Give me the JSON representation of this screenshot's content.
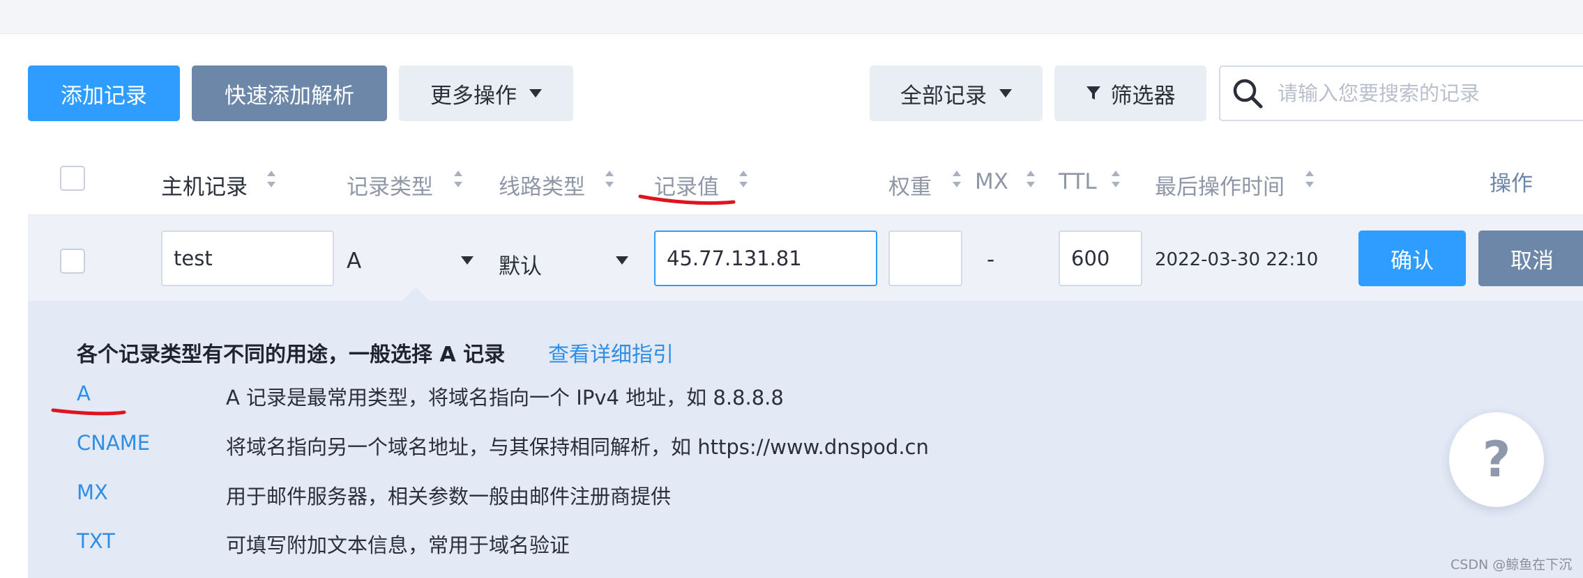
{
  "toolbar": {
    "add_record": "添加记录",
    "quick_add": "快速添加解析",
    "more_actions": "更多操作",
    "all_records": "全部记录",
    "filter": "筛选器",
    "search_placeholder": "请输入您要搜索的记录"
  },
  "table": {
    "headers": {
      "host": "主机记录",
      "type": "记录类型",
      "line": "线路类型",
      "value": "记录值",
      "weight": "权重",
      "mx": "MX",
      "ttl": "TTL",
      "last_modified": "最后操作时间",
      "actions": "操作"
    },
    "edit_row": {
      "host": "test",
      "type": "A",
      "line": "默认",
      "value": "45.77.131.81",
      "weight": "",
      "mx": "-",
      "ttl": "600",
      "last_modified": "2022-03-30 22:10",
      "confirm": "确认",
      "cancel": "取消"
    }
  },
  "help": {
    "title": "各个记录类型有不同的用途，一般选择 A 记录",
    "guide_link": "查看详细指引",
    "types": [
      {
        "type": "A",
        "desc": "A 记录是最常用类型，将域名指向一个 IPv4 地址，如 8.8.8.8"
      },
      {
        "type": "CNAME",
        "desc": "将域名指向另一个域名地址，与其保持相同解析，如 https://www.dnspod.cn"
      },
      {
        "type": "MX",
        "desc": "用于邮件服务器，相关参数一般由邮件注册商提供"
      },
      {
        "type": "TXT",
        "desc": "可填写附加文本信息，常用于域名验证"
      }
    ]
  },
  "help_fab": "?",
  "watermark": "CSDN @鲸鱼在下沉",
  "colors": {
    "primary": "#2f9cff",
    "slate": "#6d87a8",
    "link": "#2f8ee6",
    "annotation": "#e0141e"
  }
}
